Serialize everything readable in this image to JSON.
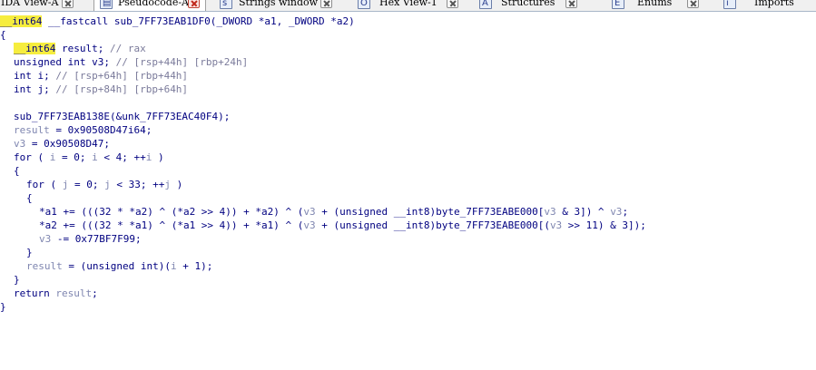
{
  "tabs": [
    {
      "label": "IDA View-A",
      "icon": "ida-view-icon",
      "active": false
    },
    {
      "label": "Pseudocode-A",
      "icon": "pseudocode-icon",
      "active": true
    },
    {
      "label": "Strings window",
      "icon": "strings-icon",
      "active": false
    },
    {
      "label": "Hex View-1",
      "icon": "hex-view-icon",
      "active": false
    },
    {
      "label": "Structures",
      "icon": "structures-icon",
      "active": false
    },
    {
      "label": "Enums",
      "icon": "enums-icon",
      "active": false
    },
    {
      "label": "Imports",
      "icon": "imports-icon",
      "active": false
    }
  ],
  "code": {
    "signature_type": "__int64",
    "signature_rest": " __fastcall sub_7FF73EAB1DF0(_DWORD *a1, _DWORD *a2)",
    "open_brace": "{",
    "decl_result_type": "__int64",
    "decl_result_name": " result; ",
    "decl_result_comment": "// rax",
    "decl_v3": "unsigned int v3; ",
    "decl_v3_comment": "// [rsp+44h] [rbp+24h]",
    "decl_i": "int i; ",
    "decl_i_comment": "// [rsp+64h] [rbp+44h]",
    "decl_j": "int j; ",
    "decl_j_comment": "// [rsp+84h] [rbp+64h]",
    "call_line": "sub_7FF73EAB138E(&unk_7FF73EAC40F4);",
    "result_var": "result",
    "result_assign": " = 0x90508D47i64;",
    "v3_var": "v3",
    "v3_assign": " = 0x90508D47;",
    "for_i_pre": "for ( ",
    "for_i_var1": "i",
    "for_i_mid1": " = 0; ",
    "for_i_var2": "i",
    "for_i_mid2": " < 4; ++",
    "for_i_var3": "i",
    "for_i_post": " )",
    "brace_open_1": "{",
    "for_j_pre": "for ( ",
    "for_j_var1": "j",
    "for_j_mid1": " = 0; ",
    "for_j_var2": "j",
    "for_j_mid2": " < 33; ++",
    "for_j_var3": "j",
    "for_j_post": " )",
    "brace_open_2": "{",
    "stmt1_a": "*a1 += (((32 * *a2) ^ (*a2 >> 4)) + *a2) ^ (",
    "stmt1_v3a": "v3",
    "stmt1_b": " + (unsigned __int8)byte_7FF73EABE000[",
    "stmt1_v3b": "v3",
    "stmt1_c": " & 3]) ^ ",
    "stmt1_v3c": "v3",
    "stmt1_d": ";",
    "stmt2_a": "*a2 += (((32 * *a1) ^ (*a1 >> 4)) + *a1) ^ (",
    "stmt2_v3a": "v3",
    "stmt2_b": " + (unsigned __int8)byte_7FF73EABE000[(",
    "stmt2_v3b": "v3",
    "stmt2_c": " >> 11) & 3]);",
    "stmt3_v3": "v3",
    "stmt3_rest": " -= 0x77BF7F99;",
    "brace_close_2": "}",
    "result_cast_var": "result",
    "result_cast_mid": " = (unsigned int)(",
    "result_cast_i": "i",
    "result_cast_end": " + 1);",
    "brace_close_1": "}",
    "return_kw": "return ",
    "return_var": "result",
    "return_end": ";",
    "close_brace": "}"
  },
  "colors": {
    "code_text": "#000080",
    "comment": "#7b7b9b",
    "local_variable": "#7f86b0",
    "highlight": "#f6ed3e"
  }
}
